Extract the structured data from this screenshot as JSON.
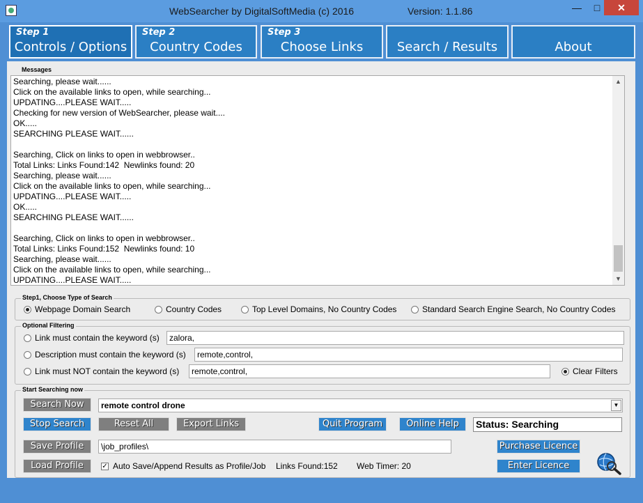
{
  "window": {
    "title": "WebSearcher by DigitalSoftMedia (c) 2016",
    "version": "Version: 1.1.86",
    "min_glyph": "—",
    "max_glyph": "□",
    "close_glyph": "✕"
  },
  "tabs": [
    {
      "step": "Step 1",
      "label": "Controls / Options"
    },
    {
      "step": "Step 2",
      "label": "Country Codes"
    },
    {
      "step": "Step 3",
      "label": "Choose Links"
    },
    {
      "step": "",
      "label": "Search / Results"
    },
    {
      "step": "",
      "label": "About"
    }
  ],
  "messages": {
    "label": "Messages",
    "lines": [
      "Searching, please wait......",
      "Click on the available links to open, while searching...",
      "UPDATING....PLEASE WAIT.....",
      "Checking for new version of WebSearcher, please wait....",
      "OK.....",
      "SEARCHING PLEASE WAIT......",
      "",
      "Searching, Click on links to open in webbrowser..",
      "Total Links: Links Found:142  Newlinks found: 20",
      "Searching, please wait......",
      "Click on the available links to open, while searching...",
      "UPDATING....PLEASE WAIT.....",
      "OK.....",
      "SEARCHING PLEASE WAIT......",
      "",
      "Searching, Click on links to open in webbrowser..",
      "Total Links: Links Found:152  Newlinks found: 10",
      "Searching, please wait......",
      "Click on the available links to open, while searching...",
      "UPDATING....PLEASE WAIT....."
    ],
    "scroll_up": "▲",
    "scroll_down": "▼"
  },
  "search_type": {
    "label": "Step1, Choose Type of Search",
    "options": [
      "Webpage Domain Search",
      "Country Codes",
      "Top Level Domains, No Country Codes",
      "Standard Search Engine Search, No Country Codes"
    ],
    "selected": "Webpage Domain Search"
  },
  "filtering": {
    "label": "Optional Filtering",
    "link_contains_label": "Link must contain the keyword (s)",
    "link_contains_value": "zalora,",
    "desc_contains_label": "Description must contain the keyword (s)",
    "desc_contains_value": "remote,control,",
    "link_not_contains_label": "Link must NOT contain the keyword (s)",
    "link_not_contains_value": "remote,control,",
    "clear_filters_label": "Clear Filters"
  },
  "start": {
    "label": "Start Searching now",
    "search_now": "Search Now",
    "query_value": "remote control drone",
    "dropdown_glyph": "▼",
    "stop_search": "Stop Search",
    "reset_all": "Reset All",
    "export_links": "Export Links",
    "quit_program": "Quit Program",
    "online_help": "Online Help",
    "status": "Status: Searching",
    "save_profile": "Save Profile",
    "profile_path": "\\job_profiles\\",
    "purchase_licence": "Purchase Licence",
    "load_profile": "Load Profile",
    "auto_save_label": "Auto Save/Append Results as Profile/Job",
    "auto_save_checked": "✓",
    "links_found": "Links Found:152",
    "web_timer": "Web Timer: 20",
    "enter_licence": "Enter Licence"
  },
  "colors": {
    "frame": "#4f8fd4",
    "tab": "#2b7fc4",
    "button_gray": "#7f7f7f",
    "button_blue": "#2f84cc",
    "close": "#c7463b"
  }
}
